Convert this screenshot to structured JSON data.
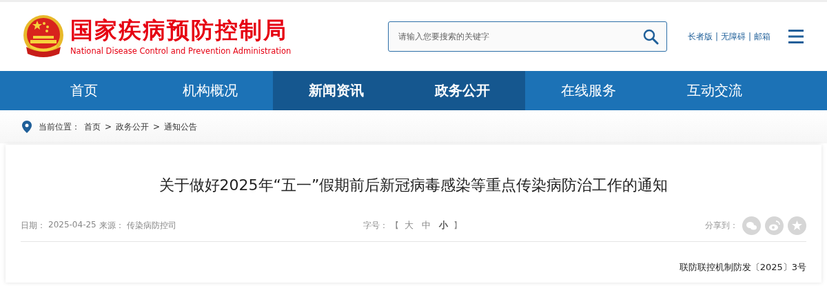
{
  "header": {
    "logo_title": "国家疾病预防控制局",
    "logo_subtitle": "National Disease Control and Prevention Administration",
    "search": {
      "placeholder": "请输入您要搜索的关键字"
    },
    "links": [
      {
        "label": "长者版"
      },
      {
        "label": "无障碍"
      },
      {
        "label": "邮箱"
      }
    ],
    "link_separator": "|"
  },
  "nav": [
    {
      "label": "首页",
      "selected": false
    },
    {
      "label": "机构概况",
      "selected": false
    },
    {
      "label": "新闻资讯",
      "selected": true
    },
    {
      "label": "政务公开",
      "selected": true
    },
    {
      "label": "在线服务",
      "selected": false
    },
    {
      "label": "互动交流",
      "selected": false
    }
  ],
  "breadcrumb": {
    "label": "当前位置：",
    "items": [
      "首页",
      "政务公开",
      "通知公告"
    ],
    "separator": ">"
  },
  "article": {
    "title": "关于做好2025年“五一”假期前后新冠病毒感染等重点传染病防治工作的通知",
    "date_label": "日期：",
    "date": "2025-04-25",
    "source_label": "来源：",
    "source": "传染病防控司",
    "font_size": {
      "label": "字号：",
      "open": "【",
      "close": "】",
      "options": [
        {
          "label": "大",
          "selected": false
        },
        {
          "label": "中",
          "selected": false
        },
        {
          "label": "小",
          "selected": true
        }
      ]
    },
    "share": {
      "label": "分享到：",
      "targets": [
        {
          "kind": "wechat"
        },
        {
          "kind": "weibo"
        },
        {
          "kind": "favorite"
        }
      ]
    },
    "doc_number": "联防联控机制防发〔2025〕3号"
  }
}
